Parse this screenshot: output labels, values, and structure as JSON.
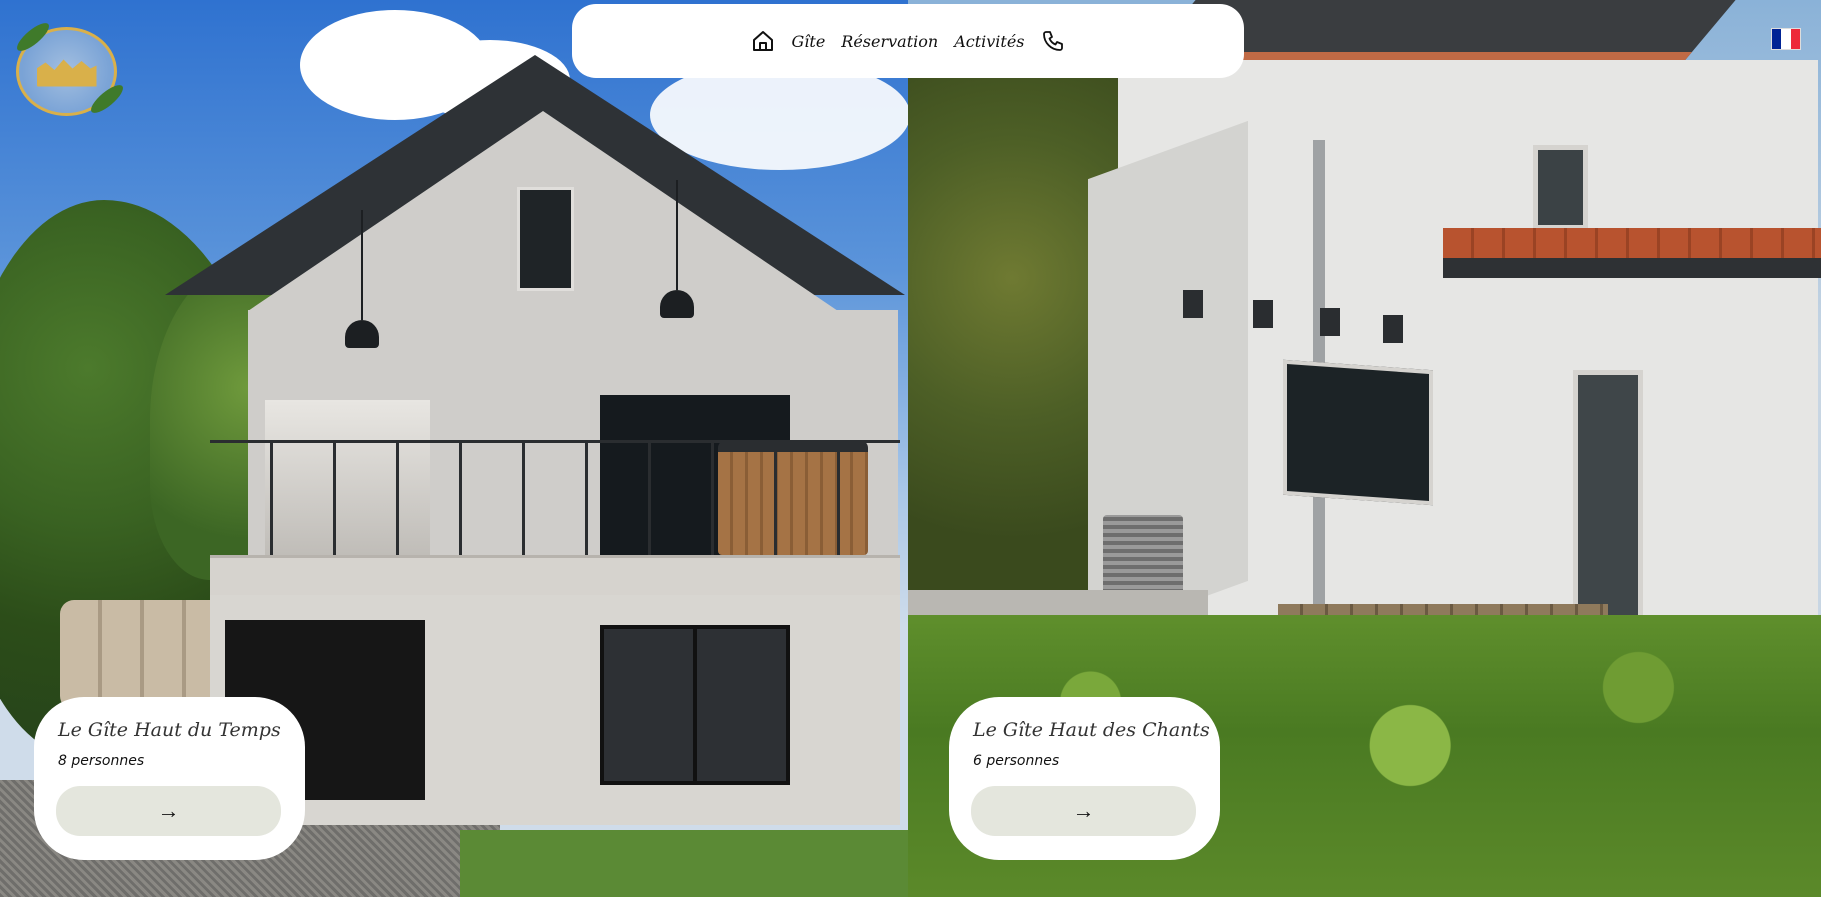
{
  "logo": {
    "icon": "gite-logo-icon"
  },
  "nav": {
    "home_icon": "home-icon",
    "items": [
      {
        "label": "Gîte"
      },
      {
        "label": "Réservation"
      },
      {
        "label": "Activités"
      }
    ],
    "phone_icon": "phone-icon"
  },
  "language": {
    "icon": "french-flag-icon",
    "colors": [
      "#002395",
      "#ffffff",
      "#ed2939"
    ]
  },
  "cards": [
    {
      "title": "Le Gîte Haut du Temps",
      "subtitle": "8 personnes",
      "button_icon": "arrow-right-icon",
      "button_label": "→"
    },
    {
      "title": "Le Gîte Haut des Chants",
      "subtitle": "6 personnes",
      "button_icon": "arrow-right-icon",
      "button_label": "→"
    }
  ],
  "colors": {
    "card_button_bg": "#e4e6dd",
    "logo_gold": "#d9b04a"
  }
}
